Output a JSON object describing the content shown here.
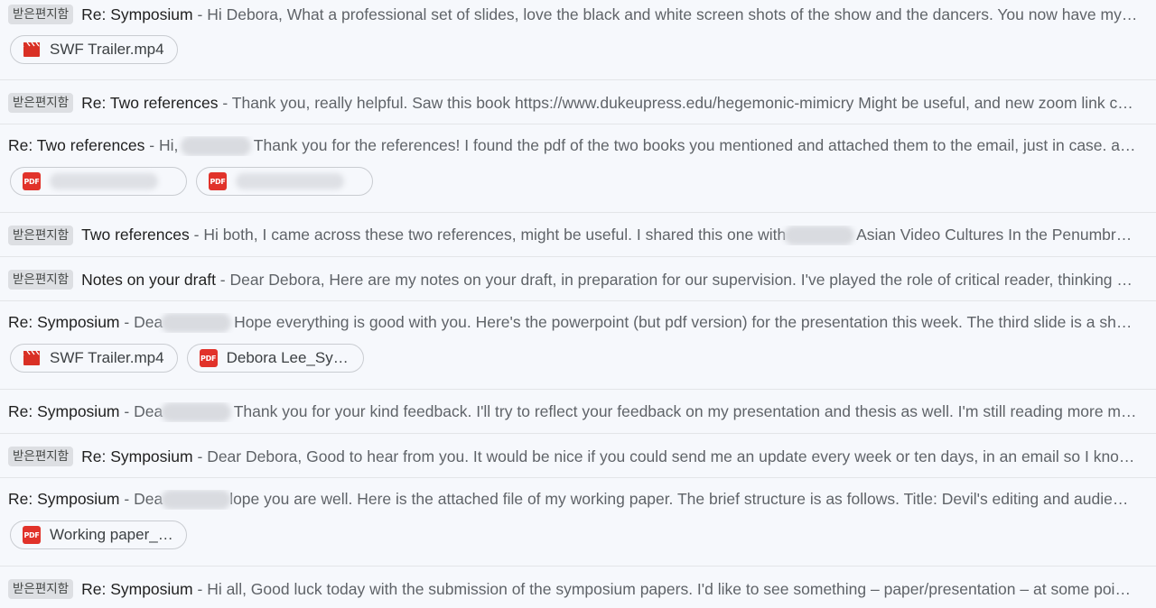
{
  "colors": {
    "background": "#f6f8fc",
    "badge": "#dddfe3",
    "pdf_icon": "#e1322a",
    "video_icon": "#d93025"
  },
  "emails": [
    {
      "badge": "받은편지함",
      "subject": "Re: Symposium",
      "snippet": "Hi Debora, What a professional set of slides, love the black and white screen shots of the show and the dancers. You now have my …",
      "attachments": [
        {
          "icon": "video-icon",
          "name": "SWF Trailer.mp4"
        }
      ]
    },
    {
      "badge": "받은편지함",
      "subject": "Re: Two references",
      "snippet": "Thank you, really helpful. Saw this book https://www.dukeupress.edu/hegemonic-mimicry Might be useful, and new zoom link c…"
    },
    {
      "badge": "",
      "subject": "Re: Two references",
      "snippet_before": "Hi,",
      "snippet_after": "Thank you for the references! I found the pdf of the two books you mentioned and attached them to the email, just in case. an…",
      "attachments": [
        {
          "icon": "pdf-icon",
          "name": ""
        },
        {
          "icon": "pdf-icon",
          "name": ""
        }
      ]
    },
    {
      "badge": "받은편지함",
      "subject": "Two references",
      "snippet_before": "Hi both, I came across these two references, might be useful. I shared this one with",
      "snippet_after": "Asian Video Cultures In the Penumbra…"
    },
    {
      "badge": "받은편지함",
      "subject": "Notes on your draft",
      "snippet": "Dear Debora, Here are my notes on your draft, in preparation for our supervision. I've played the role of critical reader, thinking a…"
    },
    {
      "badge": "",
      "subject": "Re: Symposium",
      "snippet_before": "Dea",
      "snippet_after": "Hope everything is good with you. Here's the powerpoint (but pdf version) for the presentation this week. The third slide is a sho…",
      "attachments": [
        {
          "icon": "video-icon",
          "name": "SWF Trailer.mp4"
        },
        {
          "icon": "pdf-icon",
          "name": "Debora Lee_Sy…"
        }
      ]
    },
    {
      "badge": "",
      "subject": "Re: Symposium",
      "snippet_before": "Dea",
      "snippet_after": "Thank you for your kind feedback. I'll try to reflect your feedback on my presentation and thesis as well. I'm still reading more m…"
    },
    {
      "badge": "받은편지함",
      "subject": "Re: Symposium",
      "snippet": "Dear Debora, Good to hear from you. It would be nice if you could send me an update every week or ten days, in an email so I know …"
    },
    {
      "badge": "",
      "subject": "Re: Symposium",
      "snippet_before": "Dea",
      "snippet_after": "lope you are well. Here is the attached file of my working paper. The brief structure is as follows. Title: Devil's editing and audie…",
      "attachments": [
        {
          "icon": "pdf-icon",
          "name": "Working paper_…"
        }
      ]
    },
    {
      "badge": "받은편지함",
      "subject": "Re: Symposium",
      "snippet": "Hi all, Good luck today with the submission of the symposium papers. I'd like to see something – paper/presentation – at some poi…"
    }
  ]
}
